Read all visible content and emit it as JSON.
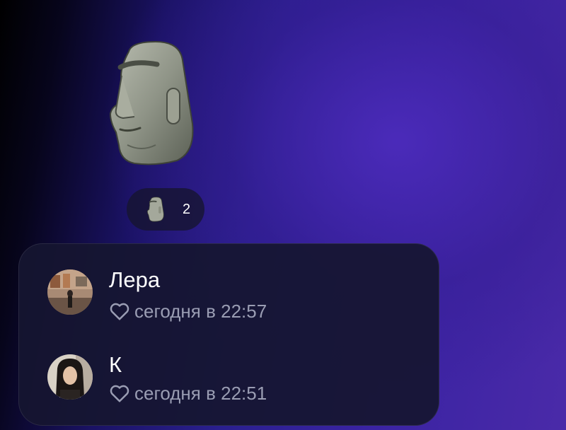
{
  "message": {
    "sticker_icon": "moai-emoji-icon",
    "reaction": {
      "icon": "moai-emoji-icon",
      "count": "2"
    }
  },
  "reactions_list": {
    "users": [
      {
        "name": "Лера",
        "time": "сегодня в 22:57",
        "icon": "heart-outline-icon"
      },
      {
        "name": "К",
        "time": "сегодня в 22:51",
        "icon": "heart-outline-icon"
      }
    ]
  },
  "colors": {
    "background_accent": "#3a23a3",
    "panel": "#161630",
    "meta_text": "#9a9db3"
  }
}
